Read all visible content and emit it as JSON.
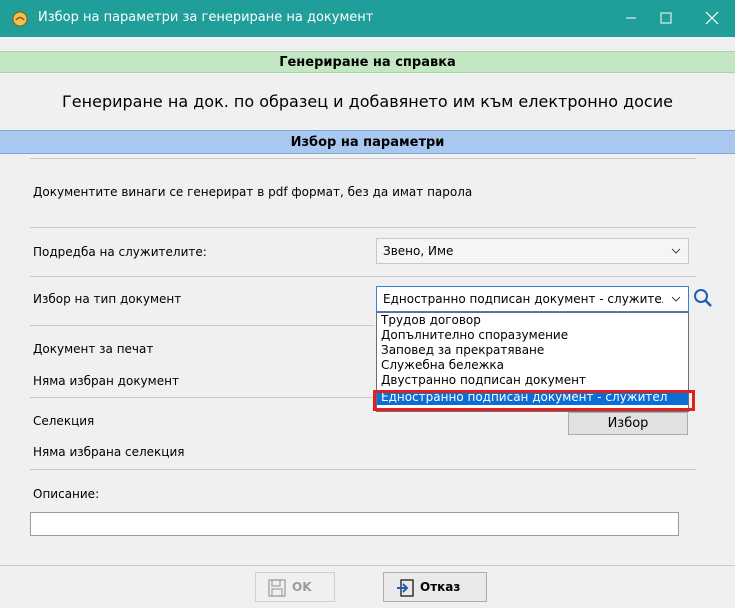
{
  "window": {
    "title": "Избор на параметри за генериране на документ"
  },
  "section_header": "Генериране на справка",
  "subtitle": "Генериране на док. по образец и добавянето им към електронно досие",
  "params_header": "Избор на параметри",
  "info_text": "Документите винаги се генерират в pdf формат, без да имат парола",
  "sort": {
    "label": "Подредба на служителите:",
    "value": "Звено, Име"
  },
  "doc_type": {
    "label": "Избор на тип документ",
    "value": "Едностранно подписан документ - служител",
    "options": [
      "Трудов договор",
      "Допълнително споразумение",
      "Заповед за прекратяване",
      "Служебна бележка",
      "Двустранно подписан документ",
      "Едностранно подписан документ - служител"
    ]
  },
  "print_doc": {
    "label": "Документ за печат",
    "value": "Няма избран документ"
  },
  "selection": {
    "label": "Селекция",
    "value": "Няма избрана селекция",
    "button": "Избор"
  },
  "description": {
    "label": "Описание:",
    "value": ""
  },
  "buttons": {
    "ok": "OK",
    "cancel": "Отказ"
  },
  "colors": {
    "titlebar": "#1f9e9a",
    "green_header": "#c3e6c3",
    "blue_header": "#a9c8ef",
    "selected": "#0a6ed4",
    "highlight": "#e02020"
  }
}
